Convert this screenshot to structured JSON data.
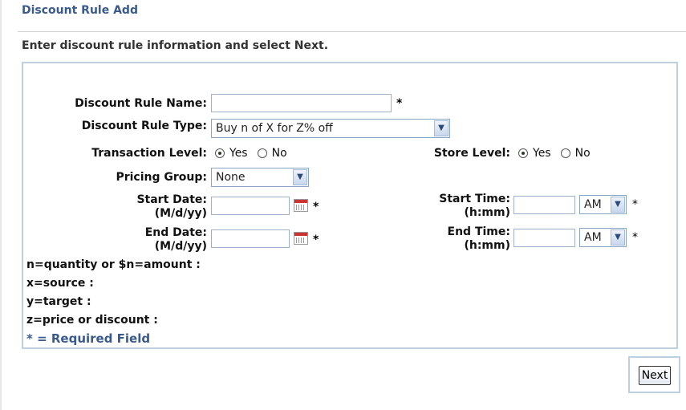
{
  "header": {
    "title": "Discount Rule Add",
    "instruction": "Enter discount rule information and select Next."
  },
  "form": {
    "rule_name": {
      "label": "Discount Rule Name:",
      "value": "",
      "required": "*"
    },
    "rule_type": {
      "label": "Discount Rule Type:",
      "selected": "Buy n of X for Z% off"
    },
    "transaction_level": {
      "label": "Transaction Level:",
      "options": [
        "Yes",
        "No"
      ],
      "selected": "Yes"
    },
    "store_level": {
      "label": "Store Level:",
      "options": [
        "Yes",
        "No"
      ],
      "selected": "Yes"
    },
    "pricing_group": {
      "label": "Pricing Group:",
      "selected": "None"
    },
    "start_date": {
      "label_line1": "Start Date:",
      "label_line2": "(M/d/yy)",
      "value": "",
      "required": "*"
    },
    "end_date": {
      "label_line1": "End Date:",
      "label_line2": "(M/d/yy)",
      "value": "",
      "required": "*"
    },
    "start_time": {
      "label_line1": "Start Time:",
      "label_line2": "(h:mm)",
      "value": "",
      "ampm": "AM",
      "required": "*"
    },
    "end_time": {
      "label_line1": "End Time:",
      "label_line2": "(h:mm)",
      "value": "",
      "ampm": "AM",
      "required": "*"
    }
  },
  "legend": {
    "n": "n=quantity or $n=amount :",
    "x": "x=source :",
    "y": "y=target :",
    "z": "z=price or discount :",
    "required_note": "* = Required Field"
  },
  "actions": {
    "next_label": "Next"
  }
}
